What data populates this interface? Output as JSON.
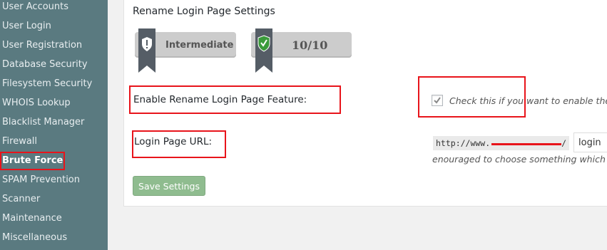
{
  "sidebar": {
    "items": [
      {
        "label": "User Accounts"
      },
      {
        "label": "User Login"
      },
      {
        "label": "User Registration"
      },
      {
        "label": "Database Security"
      },
      {
        "label": "Filesystem Security"
      },
      {
        "label": "WHOIS Lookup"
      },
      {
        "label": "Blacklist Manager"
      },
      {
        "label": "Firewall"
      },
      {
        "label": "Brute Force"
      },
      {
        "label": "SPAM Prevention"
      },
      {
        "label": "Scanner"
      },
      {
        "label": "Maintenance"
      },
      {
        "label": "Miscellaneous"
      }
    ],
    "active_index": 8
  },
  "settings": {
    "title": "Rename Login Page Settings",
    "level_badge": "Intermediate",
    "score_badge": "10/10",
    "enable_label": "Enable Rename Login Page Feature:",
    "enable_checked": true,
    "enable_desc": "Check this if you want to enable the ren",
    "url_label": "Login Page URL:",
    "url_prefix": "http://www.",
    "url_prefix_end": "/",
    "login_slug": "login",
    "url_desc": "enouraged to choose something which is ha",
    "save_label": "Save Settings"
  },
  "colors": {
    "sidebar_bg": "#5a7a80",
    "highlight": "#e8141b",
    "save_button": "#8fbc8f",
    "ribbon": "#555d66",
    "shield_green": "#3a9a3a"
  }
}
